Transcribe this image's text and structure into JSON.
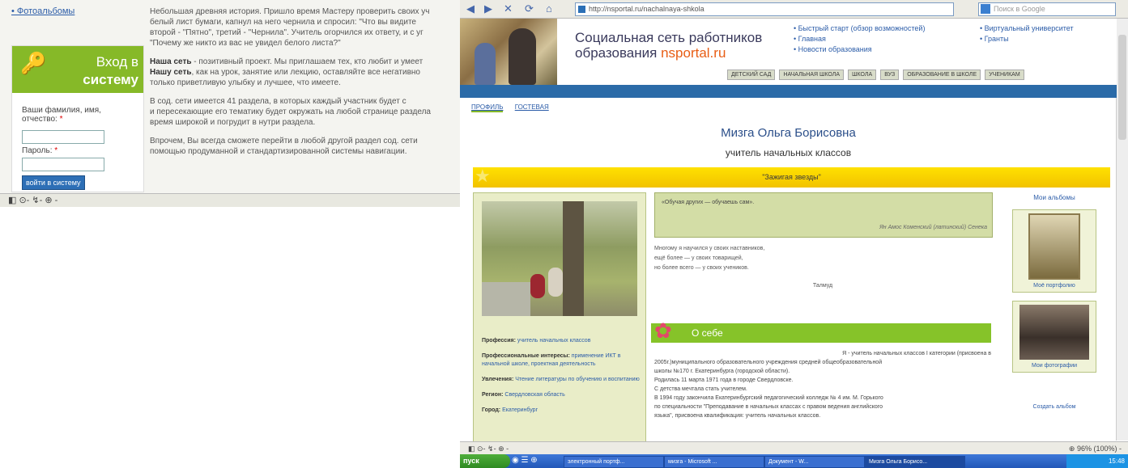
{
  "left_window": {
    "sidebar_album_link": "• Фотоальбомы",
    "login": {
      "title_line1": "Вход в",
      "title_line2": "систему",
      "name_label": "Ваши фамилия, имя, отчество:",
      "required_mark": "*",
      "password_label": "Пароль:",
      "submit_label": "войти в систему"
    },
    "text_paragraphs": [
      "Небольшая древняя история. Пришло время Мастеру проверить своих уч",
      "белый лист бумаги, капнул на него чернила и спросил: \"Что вы видите",
      "второй - \"Пятно\", третий - \"Чернила\". Учитель огорчился их ответу, и с уг",
      "\"Почему же никто из вас не увидел белого листа?\""
    ],
    "project_intro_bold": "Наша сеть",
    "project_intro": " - позитивный проект. Мы приглашаем тех, кто любит и умеет ",
    "project_intro2_bold": "Нашу сеть",
    "project_intro2": ", как на урок, занятие или лекцию, оставляйте все негативно",
    "project_intro3": "только приветливую улыбку и лучшее, что имеете.",
    "sections_text": [
      "В сод. сети имеется 41 раздела, в которых каждый участник будет с",
      "и пересекающие его тематику будет окружать на любой странице раздела",
      "время широкой и погрудит в нутри раздела."
    ],
    "nav_text": [
      "Впрочем, Вы всегда сможете перейти в любой другой раздел сод. сети",
      "помощью продуманной и стандартизированной системы навигации."
    ],
    "status_icons": "◧  ⊙- ↯- ⊕ -"
  },
  "browser": {
    "address_url": "http://nsportal.ru/nachalnaya-shkola",
    "search_placeholder": "Поиск в Google",
    "nav_buttons": [
      "◀",
      "▶",
      "✕",
      "⟳",
      "⌂"
    ]
  },
  "site": {
    "name_line1": "Социальная сеть работников",
    "name_line2": "образования ",
    "brand": "nsportal.ru",
    "links_col1": [
      "• Быстрый старт (обзор возможностей)",
      "• Главная",
      "• Новости образования"
    ],
    "links_col2": [
      "• Виртуальный университет",
      "• Гранты"
    ],
    "categories": [
      "ДЕТСКИЙ САД",
      "НАЧАЛЬНАЯ ШКОЛА",
      "ШКОЛА",
      "ВУЗ",
      "ОБРАЗОВАНИЕ В ШКОЛЕ",
      "УЧЕНИКАМ"
    ]
  },
  "profile": {
    "tabs": [
      "ПРОФИЛЬ",
      "ГОСТЕВАЯ"
    ],
    "name": "Мизга Ольга Борисовна",
    "role": "учитель начальных классов",
    "motto": "\"Зажигая звезды\"",
    "quote": "«Обучая других — обучаешь сам».",
    "quote_author": "Ян Амос Коменский (латинский) Сенека",
    "poem_lines": [
      "Многому я научился у своих наставников,",
      "ещё более — у своих товарищей,",
      "но более всего — у своих учеников."
    ],
    "poem_author": "Талмуд",
    "info": [
      {
        "k": "Профессия:",
        "v": "учитель начальных классов"
      },
      {
        "k": "Профессиональные интересы:",
        "v": "применение ИКТ в начальной школе, проектная деятельность"
      },
      {
        "k": "Увлечения:",
        "v": "Чтение литературы по обучению и воспитанию"
      },
      {
        "k": "Регион:",
        "v": "Свердловская область"
      },
      {
        "k": "Город:",
        "v": "Екатеринбург"
      }
    ],
    "about_title": "О себе",
    "about_text": [
      "Я - учитель начальных классов I категории (присвоена в",
      "2005г.)муниципального образовательного учреждения средней общеобразовательной",
      "школы №170 г. Екатеринбурга (городской области).",
      "Родилась 11 марта 1971 года в городе Свердловске.",
      "С детства мечтала стать учителем.",
      "В 1994 году закончила Екатеринбургский педагогический колледж № 4 им. М. Горького",
      "по специальности \"Преподавание в начальных классах с правом ведения английского",
      "языка\", присвоена квалификация: учитель начальных классов."
    ],
    "albums_title": "Мои альбомы",
    "albums": [
      "Моё портфолио",
      "Мои фотографии"
    ],
    "create_album": "Создать альбом"
  },
  "right_status": {
    "left": "◧  ⊙- ↯- ⊕ -",
    "right": "⊕ 96% (100%) -"
  },
  "taskbar": {
    "start": "пуск",
    "quick": "◉ ☰ ⊕",
    "tasks": [
      "электронный портф...",
      "мизга - Microsoft ...",
      "Документ - W...",
      "Мизга Ольга Борисо..."
    ],
    "clock": "15:48"
  }
}
